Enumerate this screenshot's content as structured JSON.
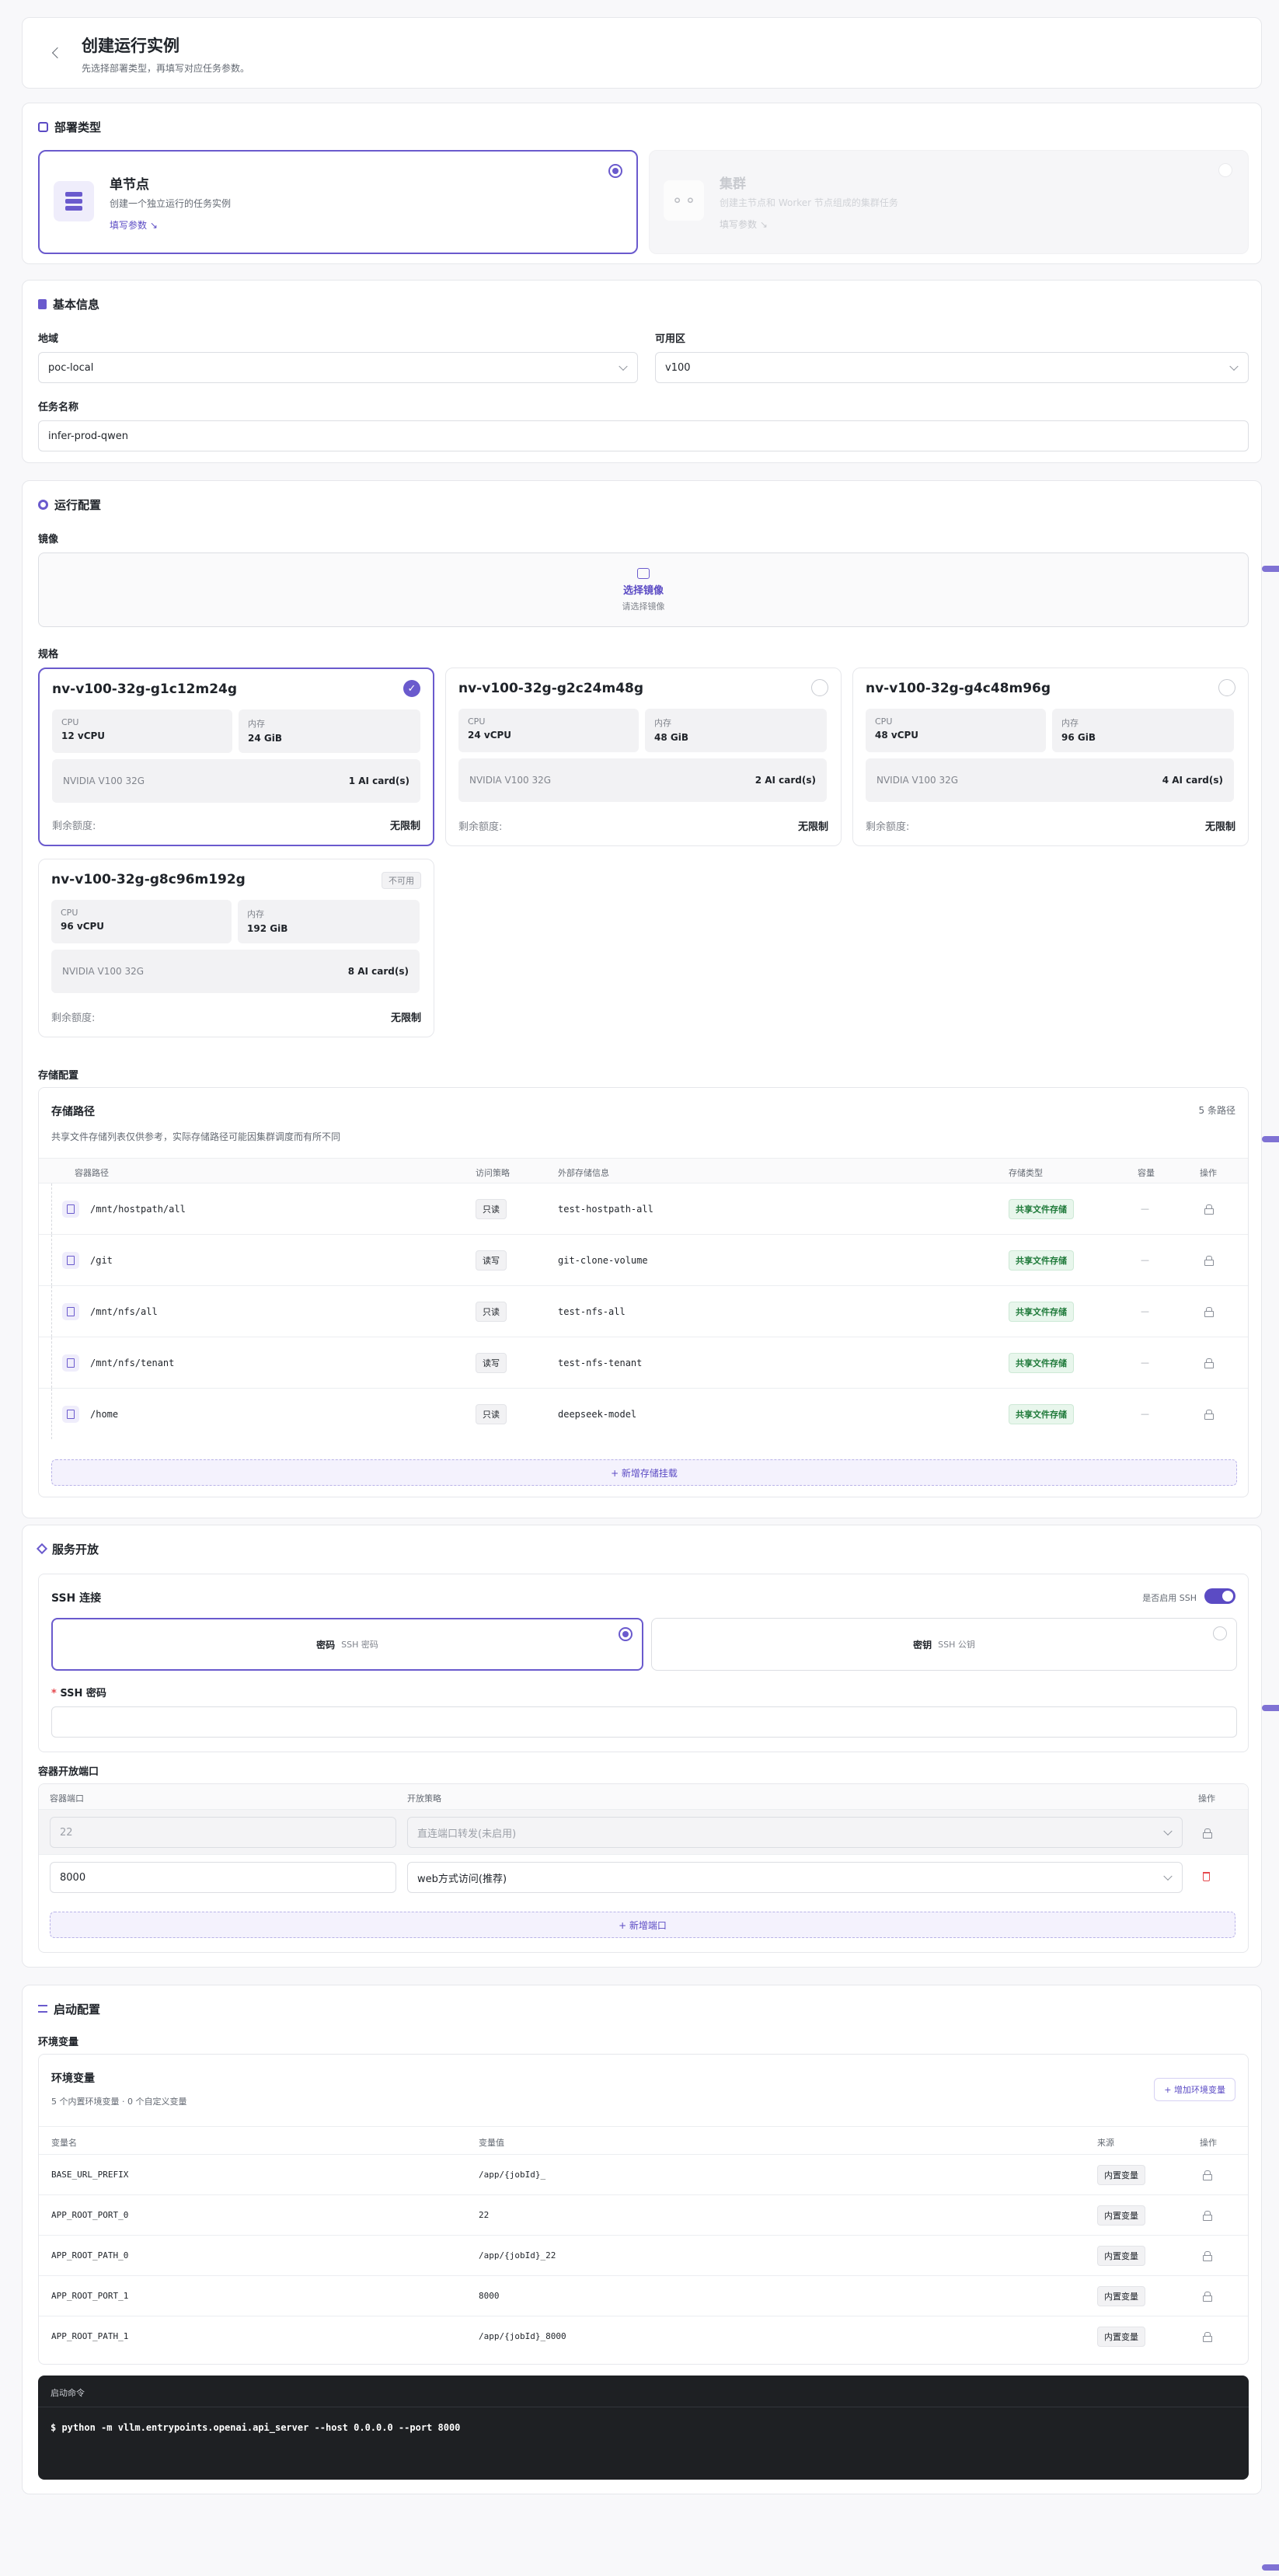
{
  "header": {
    "title": "创建运行实例",
    "subtitle": "先选择部署类型，再填写对应任务参数。"
  },
  "deploy": {
    "title": "部署类型",
    "options": [
      {
        "title": "单节点",
        "desc": "创建一个独立运行的任务实例",
        "link": "填写参数 ↘"
      },
      {
        "title": "集群",
        "desc": "创建主节点和 Worker 节点组成的集群任务",
        "link": "填写参数 ↘"
      }
    ]
  },
  "basic": {
    "title": "基本信息",
    "region_label": "地域",
    "region_value": "poc-local",
    "zone_label": "可用区",
    "zone_value": "v100",
    "name_label": "任务名称",
    "name_value": "infer-prod-qwen"
  },
  "runtime": {
    "title": "运行配置",
    "image_label": "镜像",
    "image_btn": "选择镜像",
    "image_hint": "请选择镜像",
    "spec_label": "规格",
    "specs": [
      {
        "name": "nv-v100-32g-g1c12m24g",
        "cpu_k": "CPU",
        "cpu": "12 vCPU",
        "mem_k": "内存",
        "mem": "24 GiB",
        "gpu": "NVIDIA V100 32G",
        "cards": "1 AI card(s)",
        "quota_k": "剩余额度:",
        "quota": "无限制"
      },
      {
        "name": "nv-v100-32g-g2c24m48g",
        "cpu_k": "CPU",
        "cpu": "24 vCPU",
        "mem_k": "内存",
        "mem": "48 GiB",
        "gpu": "NVIDIA V100 32G",
        "cards": "2 AI card(s)",
        "quota_k": "剩余额度:",
        "quota": "无限制"
      },
      {
        "name": "nv-v100-32g-g4c48m96g",
        "cpu_k": "CPU",
        "cpu": "48 vCPU",
        "mem_k": "内存",
        "mem": "96 GiB",
        "gpu": "NVIDIA V100 32G",
        "cards": "4 AI card(s)",
        "quota_k": "剩余额度:",
        "quota": "无限制"
      },
      {
        "name": "nv-v100-32g-g8c96m192g",
        "cpu_k": "CPU",
        "cpu": "96 vCPU",
        "mem_k": "内存",
        "mem": "192 GiB",
        "gpu": "NVIDIA V100 32G",
        "cards": "8 AI card(s)",
        "quota_k": "剩余额度:",
        "quota": "无限制",
        "tag": "不可用"
      }
    ],
    "storage_label": "存储配置",
    "storage_title": "存储路径",
    "storage_count": "5 条路径",
    "storage_note": "共享文件存储列表仅供参考，实际存储路径可能因集群调度而有所不同",
    "storage_cols": [
      "容器路径",
      "访问策略",
      "外部存储信息",
      "存储类型",
      "容量",
      "操作"
    ],
    "storage_rows": [
      {
        "path": "/mnt/hostpath/all",
        "policy": "只读",
        "ext": "test-hostpath-all",
        "type": "共享文件存储",
        "cap": "—"
      },
      {
        "path": "/git",
        "policy": "读写",
        "ext": "git-clone-volume",
        "type": "共享文件存储",
        "cap": "—"
      },
      {
        "path": "/mnt/nfs/all",
        "policy": "只读",
        "ext": "test-nfs-all",
        "type": "共享文件存储",
        "cap": "—"
      },
      {
        "path": "/mnt/nfs/tenant",
        "policy": "读写",
        "ext": "test-nfs-tenant",
        "type": "共享文件存储",
        "cap": "—"
      },
      {
        "path": "/home",
        "policy": "只读",
        "ext": "deepseek-model",
        "type": "共享文件存储",
        "cap": "—"
      }
    ],
    "storage_add": "+ 新增存储挂载"
  },
  "service": {
    "title": "服务开放",
    "ssh_title": "SSH 连接",
    "ssh_toggle": "是否启用 SSH",
    "pw_title": "密码",
    "pw_sub": "SSH 密码",
    "key_title": "密钥",
    "key_sub": "SSH 公钥",
    "pw_label": "SSH 密码",
    "pw_required": "*",
    "ports_label": "容器开放端口",
    "ports_cols": [
      "容器端口",
      "开放策略",
      "操作"
    ],
    "ports": [
      {
        "port": "22",
        "policy": "直连端口转发(未启用)"
      },
      {
        "port": "8000",
        "policy": "web方式访问(推荐)"
      }
    ],
    "ports_add": "+ 新增端口"
  },
  "launch": {
    "title": "启动配置",
    "env_label": "环境变量",
    "env_title": "环境变量",
    "env_sub": "5 个内置环境变量 · 0 个自定义变量",
    "env_add": "+ 增加环境变量",
    "env_cols": [
      "变量名",
      "变量值",
      "来源",
      "操作"
    ],
    "env_rows": [
      {
        "name": "BASE_URL_PREFIX",
        "value": "/app/{jobId}_",
        "src": "内置变量"
      },
      {
        "name": "APP_ROOT_PORT_0",
        "value": "22",
        "src": "内置变量"
      },
      {
        "name": "APP_ROOT_PATH_0",
        "value": "/app/{jobId}_22",
        "src": "内置变量"
      },
      {
        "name": "APP_ROOT_PORT_1",
        "value": "8000",
        "src": "内置变量"
      },
      {
        "name": "APP_ROOT_PATH_1",
        "value": "/app/{jobId}_8000",
        "src": "内置变量"
      }
    ],
    "cmd_label": "启动命令",
    "cmd": "$ python -m vllm.entrypoints.openai.api_server --host 0.0.0.0 --port 8000"
  },
  "colors": {
    "accent": "#6a5acd",
    "terminal": "#1e2023"
  }
}
